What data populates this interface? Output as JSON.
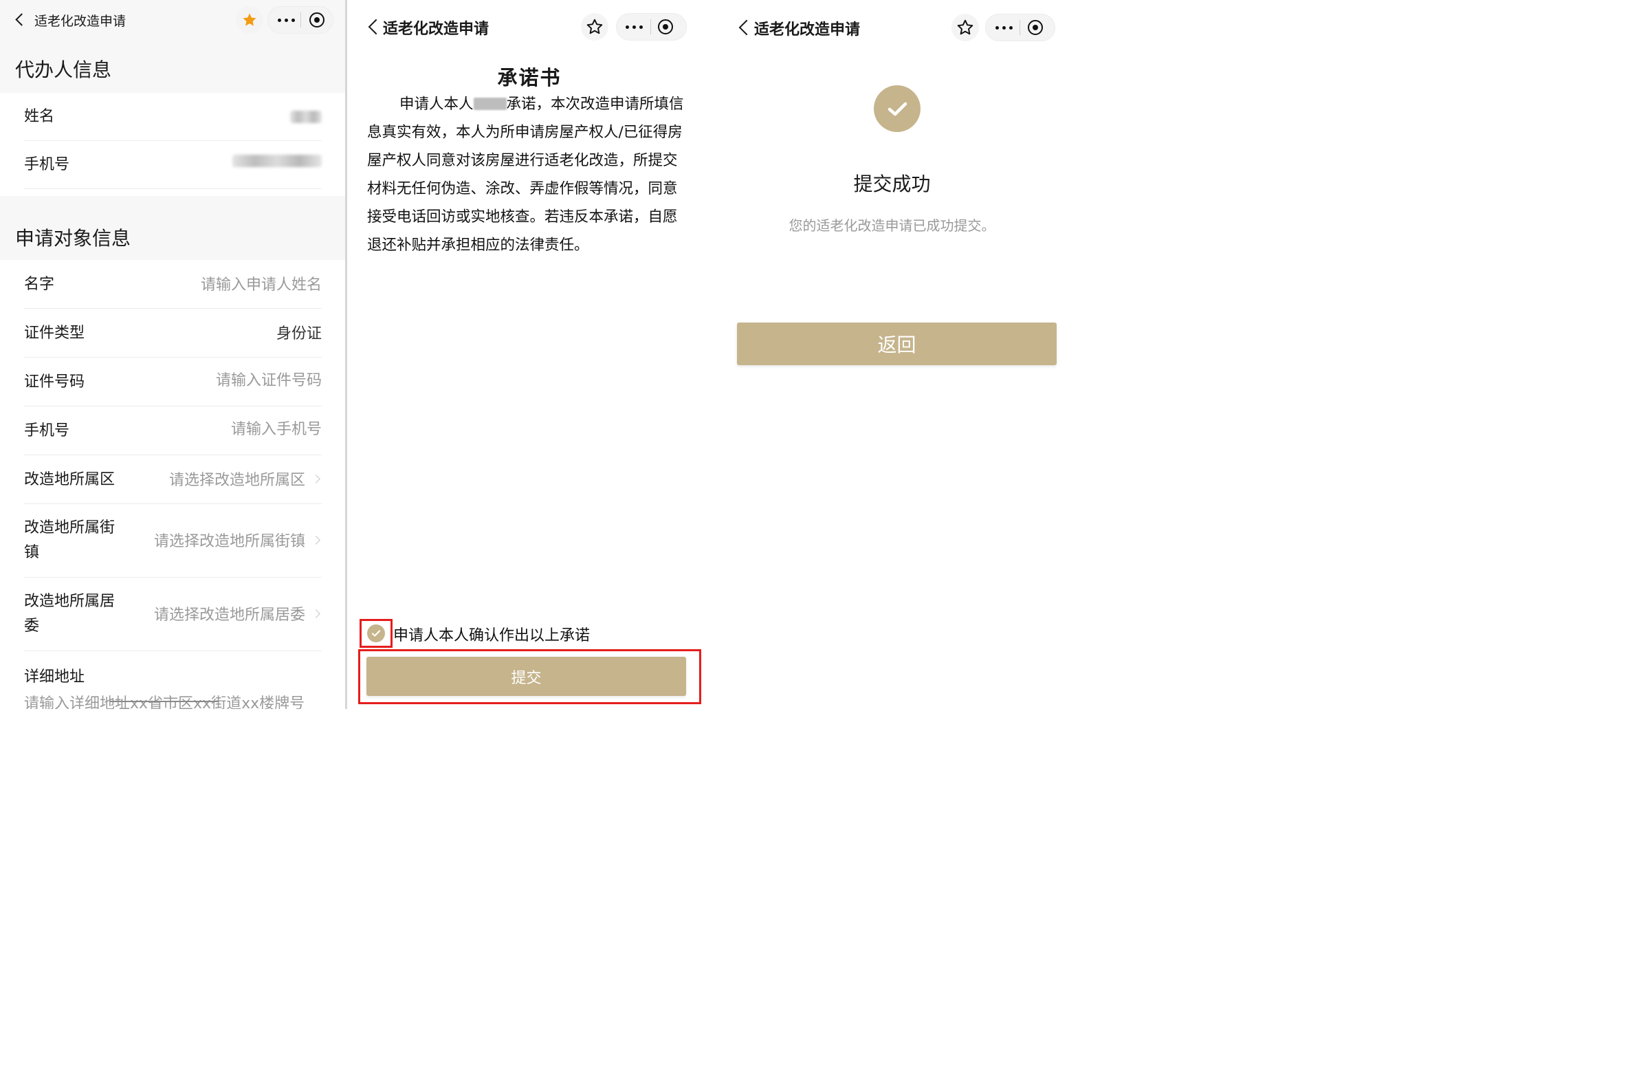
{
  "app_title": "适老化改造申请",
  "colors": {
    "accent": "#c6b48c",
    "highlight": "#e51d1d",
    "star_active": "#f39c12"
  },
  "form_screen": {
    "agent_section": "代办人信息",
    "agent_fields": [
      {
        "label": "姓名"
      },
      {
        "label": "手机号"
      }
    ],
    "subject_section": "申请对象信息",
    "subject_fields": [
      {
        "label": "名字",
        "placeholder": "请输入申请人姓名"
      },
      {
        "label": "证件类型",
        "value": "身份证"
      },
      {
        "label": "证件号码",
        "placeholder": "请输入证件号码"
      },
      {
        "label": "手机号",
        "placeholder": "请输入手机号"
      },
      {
        "label": "改造地所属区",
        "placeholder": "请选择改造地所属区"
      },
      {
        "label": "改造地所属街镇",
        "placeholder": "请选择改造地所属街镇"
      },
      {
        "label": "改造地所属居委",
        "placeholder": "请选择改造地所属居委"
      },
      {
        "label": "详细地址",
        "placeholder": "请输入详细地址xx省市区xx街道xx楼牌号"
      }
    ]
  },
  "pledge_screen": {
    "title": "承诺书",
    "body_prefix": "申请人本人",
    "body_rest": "承诺，本次改造申请所填信息真实有效，本人为所申请房屋产权人/已征得房屋产权人同意对该房屋进行适老化改造，所提交材料无任何伪造、涂改、弄虚作假等情况，同意接受电话回访或实地核查。若违反本承诺，自愿退还补贴并承担相应的法律责任。",
    "confirm_text": "申请人本人确认作出以上承诺",
    "submit_label": "提交"
  },
  "success_screen": {
    "title": "提交成功",
    "message": "您的适老化改造申请已成功提交。",
    "back_label": "返回"
  },
  "icons": [
    "back-chevron-icon",
    "star-icon",
    "more-dots-icon",
    "target-icon",
    "check-icon",
    "chevron-right-icon"
  ]
}
